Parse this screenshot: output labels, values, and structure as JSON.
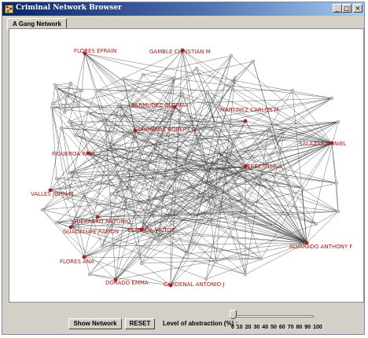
{
  "window": {
    "title": "Criminal Network Browser",
    "minimize": "_",
    "maximize": "□",
    "close": "×"
  },
  "tabs": [
    {
      "label": "A Gang Network",
      "selected": true
    }
  ],
  "network": {
    "node_color": "#c8c8c8",
    "labeled_node_color": "#b02020",
    "label_color": "#a81818",
    "edge_color": "#3a3a3a",
    "labels": [
      "FLORES EFRAIN",
      "GAMBLE CHRISTIAN M",
      "BERMUDEZ GLORIA I",
      "CORONADA ROBERT G",
      "MARTINEZ CARLOS M",
      "SALAZAR DANIEL",
      "FIGUEROA RAUL",
      "PEREZ JOSE A",
      "VALLES JOHN M",
      "GUERRERO ANTONIO",
      "GUADALUPE RAMON",
      "ESTRADA VICTOR",
      "ALVARADO ANTHONY F",
      "FLORES ANA",
      "DORADO EMMA",
      "CARDENAL ANTONIO J"
    ]
  },
  "controls": {
    "show_network_label": "Show Network",
    "reset_label": "RESET",
    "abstraction_label": "Level of abstraction (%) :",
    "abstraction_value": 0,
    "tick_labels": [
      "0",
      "10",
      "20",
      "30",
      "40",
      "50",
      "60",
      "70",
      "80",
      "90",
      "100"
    ]
  }
}
